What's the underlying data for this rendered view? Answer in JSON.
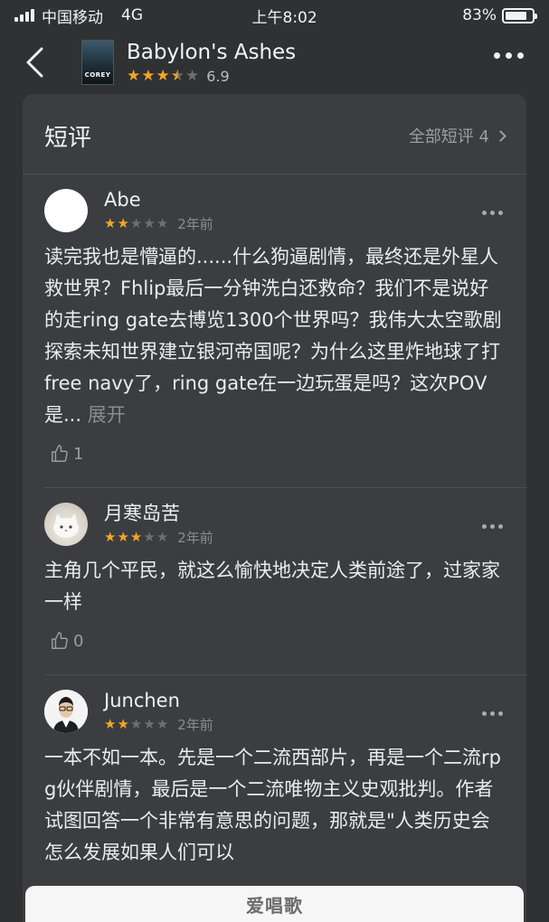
{
  "status_bar": {
    "carrier": "中国移动",
    "network": "4G",
    "time": "上午8:02",
    "battery_text": "83%",
    "battery_level": 0.83
  },
  "header": {
    "book_title": "Babylon's Ashes",
    "rating": 6.9,
    "rating_text": "6.9",
    "cover_text": "COREY"
  },
  "section": {
    "title": "短评",
    "all_reviews_label": "全部短评 4"
  },
  "reviews": [
    {
      "username": "Abe",
      "stars": 2,
      "time": "2年前",
      "text": "读完我也是懵逼的......什么狗逼剧情，最终还是外星人救世界？Fhlip最后一分钟洗白还救命？我们不是说好的走ring gate去博览1300个世界吗？我伟大太空歌剧探索未知世界建立银河帝国呢？为什么这里炸地球了打free navy了，ring gate在一边玩蛋是吗？这次POV是...",
      "expand": " 展开",
      "likes": "1"
    },
    {
      "username": "月寒岛苦",
      "stars": 3,
      "time": "2年前",
      "text": "主角几个平民，就这么愉快地决定人类前途了，过家家一样",
      "likes": "0"
    },
    {
      "username": "Junchen",
      "stars": 2,
      "time": "2年前",
      "text": "一本不如一本。先是一个二流西部片，再是一个二流rpg伙伴剧情，最后是一个二流唯物主义史观批判。作者试图回答一个非常有意思的问题，那就是\"人类历史会怎么发展如果人们可以"
    }
  ],
  "watermark": "爱唱歌",
  "colors": {
    "background": "#2f3133",
    "card": "#3b3d40",
    "star_on": "#f4a623",
    "star_off": "#6d6f71"
  }
}
